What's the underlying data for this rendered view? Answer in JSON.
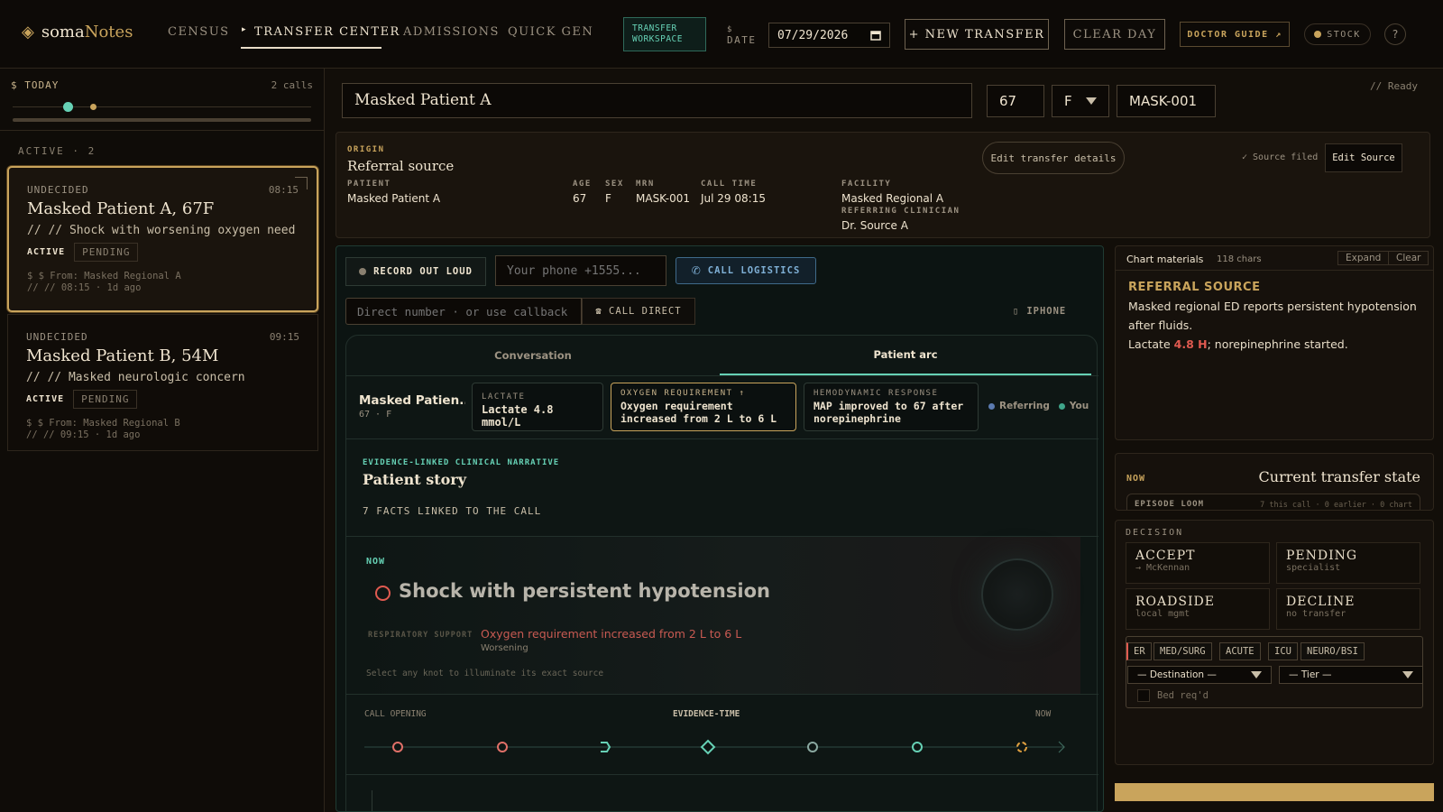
{
  "brand": {
    "prefix": "soma",
    "suffix": "Notes",
    "glyph": "◈"
  },
  "nav": [
    {
      "label": "CENSUS",
      "active": false
    },
    {
      "label": "TRANSFER CENTER",
      "active": true
    },
    {
      "label": "ADMISSIONS",
      "active": false
    },
    {
      "label": "QUICK GEN",
      "active": false
    }
  ],
  "nav_arrow": "▸",
  "workspace_badge": "TRANSFER WORKSPACE",
  "date": {
    "prefix": "$",
    "label": "DATE",
    "value": "07/29/2026",
    "icon": "calendar-icon"
  },
  "buttons": {
    "new_transfer": "+ NEW TRANSFER",
    "clear_day": "CLEAR DAY",
    "doctor_guide": "DOCTOR GUIDE ↗",
    "stock": "STOCK",
    "help": "?"
  },
  "left": {
    "today": "$ TODAY",
    "calls": "2 calls",
    "active_heading": "ACTIVE · 2",
    "cards": [
      {
        "status": "UNDECIDED",
        "time": "08:15",
        "name": "Masked Patient A, 67F",
        "complaint": "// // Shock with worsening oxygen need",
        "active": "ACTIVE",
        "pending": "PENDING",
        "from": "$ $ From: Masked Regional A",
        "ago": "// // 08:15 · 1d ago"
      },
      {
        "status": "UNDECIDED",
        "time": "09:15",
        "name": "Masked Patient B, 54M",
        "complaint": "// // Masked neurologic concern",
        "active": "ACTIVE",
        "pending": "PENDING",
        "from": "$ $ From: Masked Regional B",
        "ago": "// // 09:15 · 1d ago"
      }
    ]
  },
  "patient": {
    "name": "Masked Patient A",
    "age": "67",
    "sex": "F",
    "mrn": "MASK-001"
  },
  "ready": "// Ready",
  "origin": {
    "kicker": "ORIGIN",
    "title": "Referral source",
    "fields": [
      {
        "label": "PATIENT",
        "value": "Masked Patient A"
      },
      {
        "label": "AGE",
        "value": "67"
      },
      {
        "label": "SEX",
        "value": "F"
      },
      {
        "label": "MRN",
        "value": "MASK-001"
      },
      {
        "label": "CALL TIME",
        "value": "Jul 29 08:15"
      },
      {
        "label": "FACILITY",
        "value": "Masked Regional A"
      },
      {
        "label": "REFERRING CLINICIAN",
        "value": "Dr. Source A"
      }
    ],
    "edit_transfer": "Edit transfer details",
    "source_filed": "✓ Source filed",
    "edit_source": "Edit Source"
  },
  "callbar": {
    "record": "RECORD OUT LOUD",
    "phone_placeholder": "Your phone +1555...",
    "call_logistics": "CALL LOGISTICS",
    "direct_placeholder": "Direct number · or use callback",
    "call_direct": "☎ CALL DIRECT",
    "iphone": "IPHONE"
  },
  "tabs": [
    {
      "label": "Conversation",
      "active": false
    },
    {
      "label": "Patient arc",
      "active": true
    }
  ],
  "summary": {
    "name": "Masked Patien...",
    "meta": "67 · F",
    "cards": [
      {
        "label": "LACTATE",
        "value": "Lactate 4.8 mmol/L"
      },
      {
        "label": "OXYGEN REQUIREMENT ↑",
        "value": "Oxygen requirement increased from 2 L to 6 L"
      },
      {
        "label": "HEMODYNAMIC RESPONSE",
        "value": "MAP improved to 67 after norepinephrine"
      }
    ],
    "legend": [
      {
        "label": "Referring",
        "color": "#5b7bb0"
      },
      {
        "label": "You",
        "color": "#3fa58a"
      }
    ]
  },
  "story": {
    "kicker": "EVIDENCE-LINKED CLINICAL NARRATIVE",
    "title": "Patient story",
    "facts": "7 FACTS LINKED TO THE CALL"
  },
  "now_panel": {
    "kicker": "NOW",
    "headline": "Shock with persistent hypotension",
    "support_label": "RESPIRATORY SUPPORT",
    "support_value": "Oxygen requirement increased from 2 L to 6 L",
    "support_note": "Worsening",
    "hint": "Select any knot to illuminate its exact source"
  },
  "timeline": {
    "start": "CALL OPENING",
    "mid": "EVIDENCE-TIME",
    "end": "NOW"
  },
  "chart_materials": {
    "title": "Chart materials",
    "chars": "118 chars",
    "expand": "Expand",
    "clear": "Clear",
    "heading": "REFERRAL SOURCE",
    "line1": "Masked regional ED reports persistent hypotension after fluids.",
    "line2a": "Lactate ",
    "line2b": "4.8 H",
    "line2c": "; norepinephrine started."
  },
  "transfer_state": {
    "now": "NOW",
    "title": "Current transfer state",
    "loom": "EPISODE LOOM",
    "loom_meta": "7 this call · 0 earlier · 0 chart"
  },
  "decision": {
    "heading": "DECISION",
    "options": [
      {
        "a": "ACCEPT",
        "b": "→ McKennan"
      },
      {
        "a": "PENDING",
        "b": "specialist"
      },
      {
        "a": "ROADSIDE",
        "b": "local mgmt"
      },
      {
        "a": "DECLINE",
        "b": "no transfer"
      }
    ],
    "units": [
      "ER",
      "MED/SURG",
      "ACUTE",
      "ICU",
      "NEURO/BSI"
    ],
    "destination": "— Destination —",
    "tier": "— Tier —",
    "bed": "Bed req'd"
  },
  "colors": {
    "accent": "#c9a45c",
    "teal": "#66d1b5",
    "alert": "#e05a50"
  }
}
